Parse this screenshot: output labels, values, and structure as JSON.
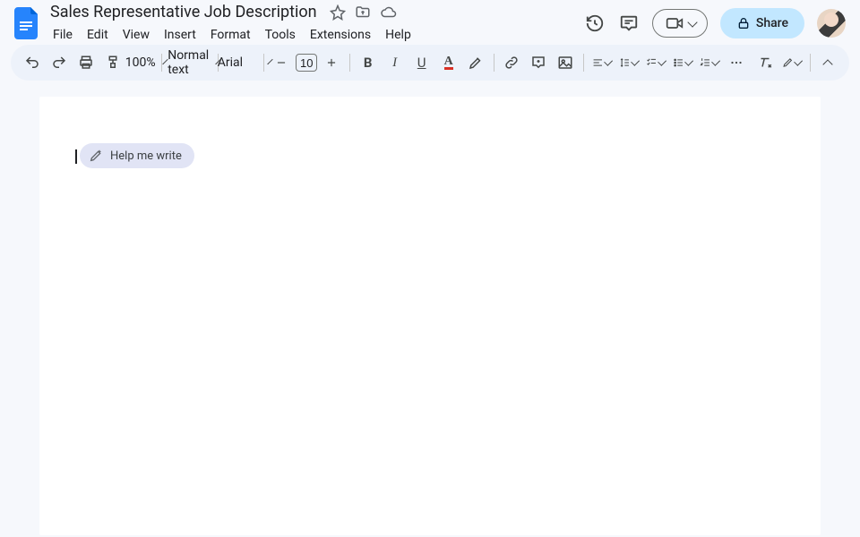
{
  "document": {
    "title": "Sales Representative Job Description"
  },
  "menus": {
    "file": "File",
    "edit": "Edit",
    "view": "View",
    "insert": "Insert",
    "format": "Format",
    "tools": "Tools",
    "extensions": "Extensions",
    "help": "Help"
  },
  "toolbar": {
    "zoom": "100%",
    "style": "Normal text",
    "font": "Arial",
    "font_size": "10"
  },
  "header": {
    "share_label": "Share"
  },
  "body": {
    "help_write_label": "Help me write"
  }
}
